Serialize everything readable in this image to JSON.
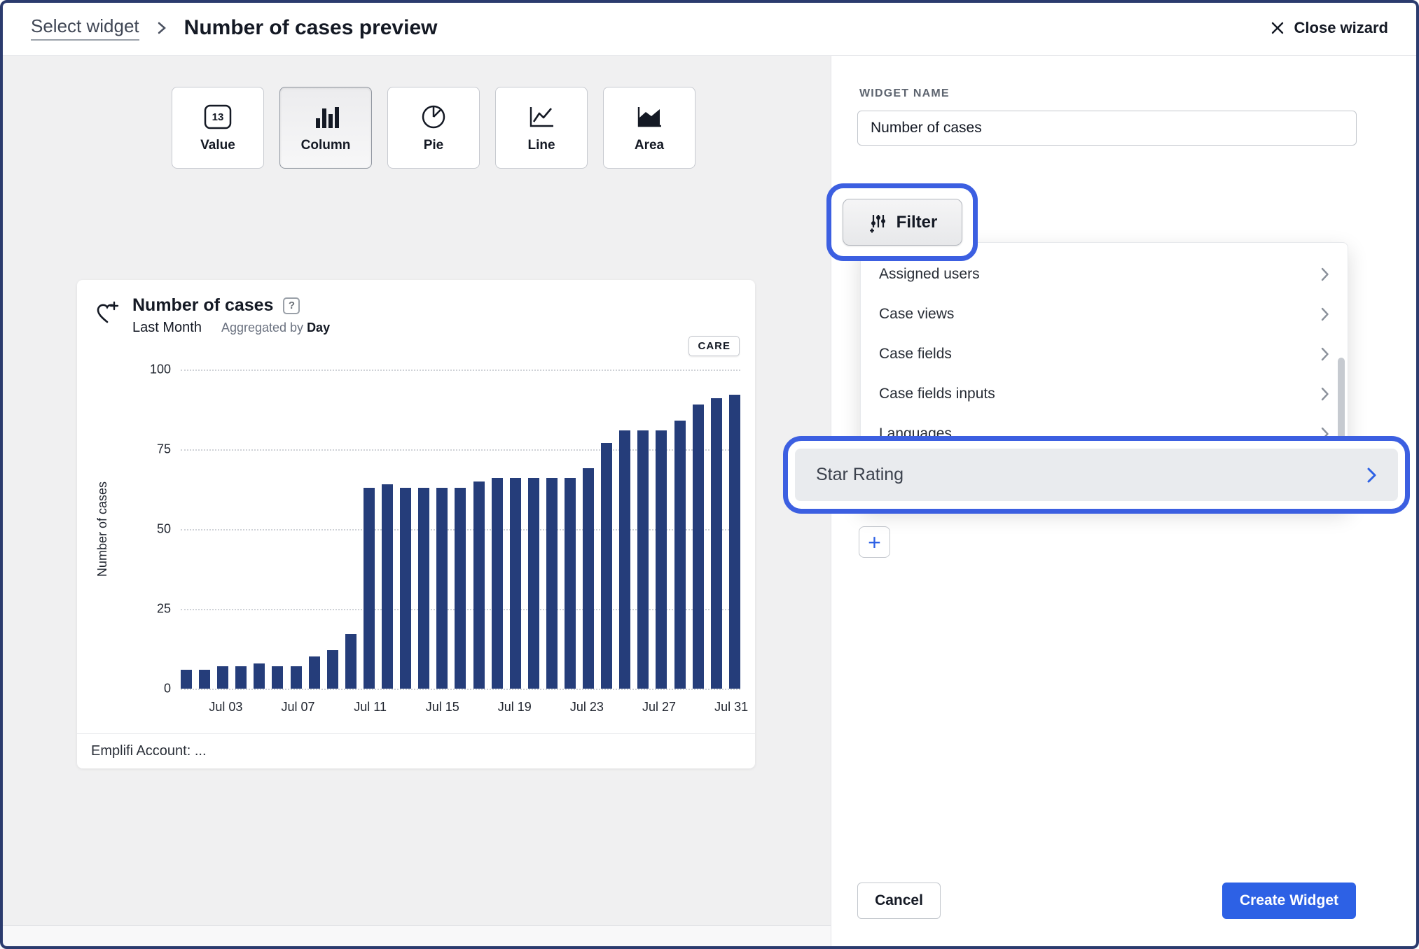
{
  "header": {
    "breadcrumb": "Select widget",
    "title": "Number of cases preview",
    "close_label": "Close wizard"
  },
  "chart_types": [
    {
      "label": "Value"
    },
    {
      "label": "Column"
    },
    {
      "label": "Pie"
    },
    {
      "label": "Line"
    },
    {
      "label": "Area"
    }
  ],
  "preview_card": {
    "title": "Number of cases",
    "help_icon": "?",
    "period": "Last Month",
    "aggregated_prefix": "Aggregated by",
    "aggregated_value": "Day",
    "badge": "CARE",
    "footer": "Emplifi Account: ..."
  },
  "chart_data": {
    "type": "bar",
    "title": "Number of cases",
    "period": "Last Month",
    "aggregation": "Day",
    "ylabel": "Number of cases",
    "ylim": [
      0,
      100
    ],
    "yticks": [
      0,
      25,
      50,
      75,
      100
    ],
    "grid": "dotted-horizontal",
    "bar_color": "#253d7a",
    "values": [
      6,
      6,
      7,
      7,
      8,
      7,
      7,
      10,
      12,
      17,
      63,
      64,
      63,
      63,
      63,
      63,
      65,
      66,
      66,
      66,
      66,
      66,
      69,
      77,
      81,
      81,
      81,
      84,
      89,
      91,
      92
    ],
    "x_labels": [
      {
        "index": 2,
        "label": "Jul 03"
      },
      {
        "index": 6,
        "label": "Jul 07"
      },
      {
        "index": 10,
        "label": "Jul 11"
      },
      {
        "index": 14,
        "label": "Jul 15"
      },
      {
        "index": 18,
        "label": "Jul 19"
      },
      {
        "index": 22,
        "label": "Jul 23"
      },
      {
        "index": 26,
        "label": "Jul 27"
      },
      {
        "index": 30,
        "label": "Jul 31"
      }
    ]
  },
  "panel": {
    "widget_name_label": "WIDGET NAME",
    "widget_name_value": "Number of cases",
    "filter_button": "Filter",
    "dropdown_items": [
      "Assigned users",
      "Case views",
      "Case fields",
      "Case fields inputs",
      "Languages"
    ],
    "highlighted_item": "Star Rating",
    "add_button": "+",
    "cancel_label": "Cancel",
    "create_label": "Create Widget"
  },
  "colors": {
    "bar": "#253d7a",
    "accent_blue": "#2d61e5",
    "annotation_blue": "#3c5fe1",
    "frame_border": "#2b3b6e"
  }
}
